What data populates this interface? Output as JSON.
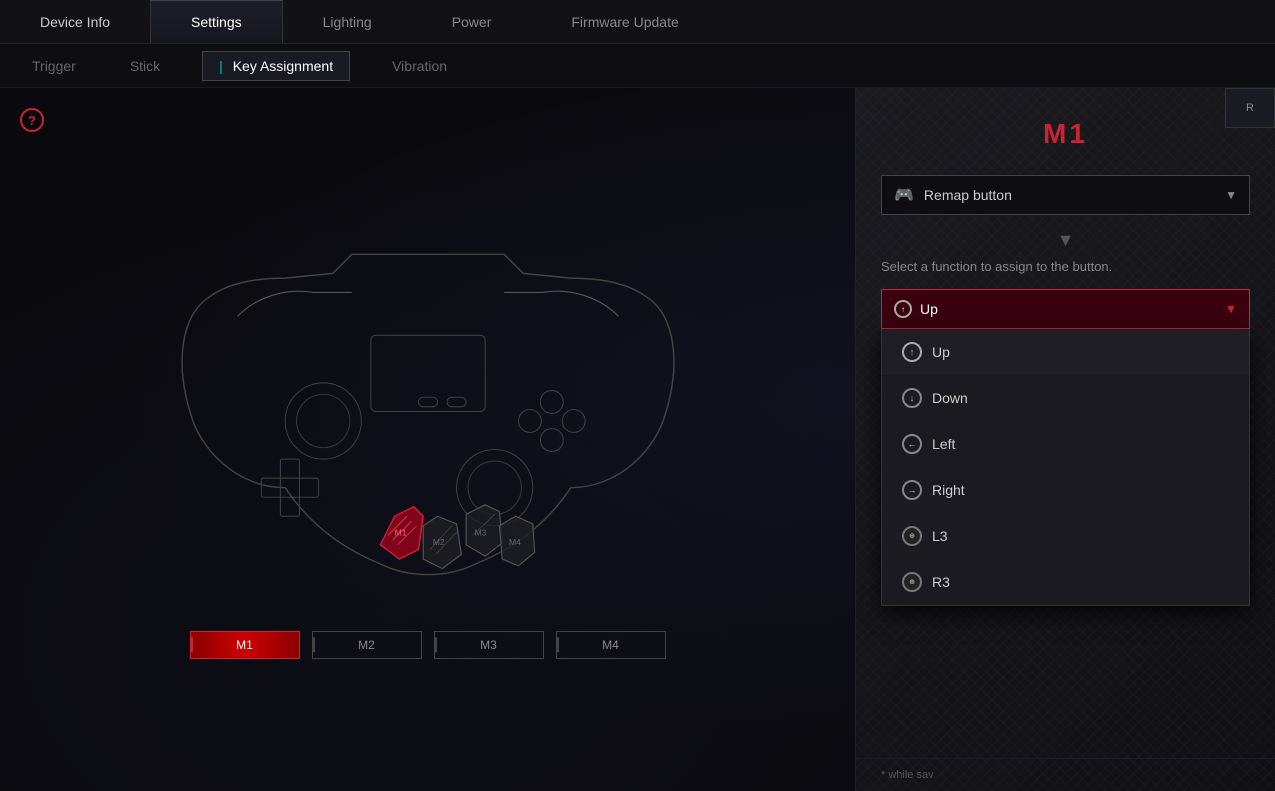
{
  "nav": {
    "items": [
      {
        "id": "device-info",
        "label": "Device Info",
        "active": false
      },
      {
        "id": "settings",
        "label": "Settings",
        "active": true
      },
      {
        "id": "lighting",
        "label": "Lighting",
        "active": false
      },
      {
        "id": "power",
        "label": "Power",
        "active": false
      },
      {
        "id": "firmware-update",
        "label": "Firmware Update",
        "active": false
      }
    ]
  },
  "sub_nav": {
    "items": [
      {
        "id": "trigger",
        "label": "Trigger",
        "active": false
      },
      {
        "id": "stick",
        "label": "Stick",
        "active": false
      },
      {
        "id": "key-assignment",
        "label": "Key Assignment",
        "active": true
      },
      {
        "id": "vibration",
        "label": "Vibration",
        "active": false
      }
    ]
  },
  "controller": {
    "m_buttons": [
      {
        "id": "M1",
        "label": "M1",
        "active": true
      },
      {
        "id": "M2",
        "label": "M2",
        "active": false
      },
      {
        "id": "M3",
        "label": "M3",
        "active": false
      },
      {
        "id": "M4",
        "label": "M4",
        "active": false
      }
    ]
  },
  "panel": {
    "title": "M1",
    "remap_label": "Remap button",
    "select_text": "Select a function to assign to the button.",
    "selected_function": "Up",
    "gamepad_icon": "🎮",
    "dropdown_arrow": "▼",
    "large_arrow": "▼",
    "functions": [
      {
        "id": "up",
        "label": "Up",
        "selected": true
      },
      {
        "id": "down",
        "label": "Down",
        "selected": false
      },
      {
        "id": "left",
        "label": "Left",
        "selected": false
      },
      {
        "id": "right",
        "label": "Right",
        "selected": false
      },
      {
        "id": "l3",
        "label": "L3",
        "selected": false
      },
      {
        "id": "r3",
        "label": "R3",
        "selected": false
      }
    ]
  },
  "bottom_note": "*  while sav",
  "help_icon": "?"
}
